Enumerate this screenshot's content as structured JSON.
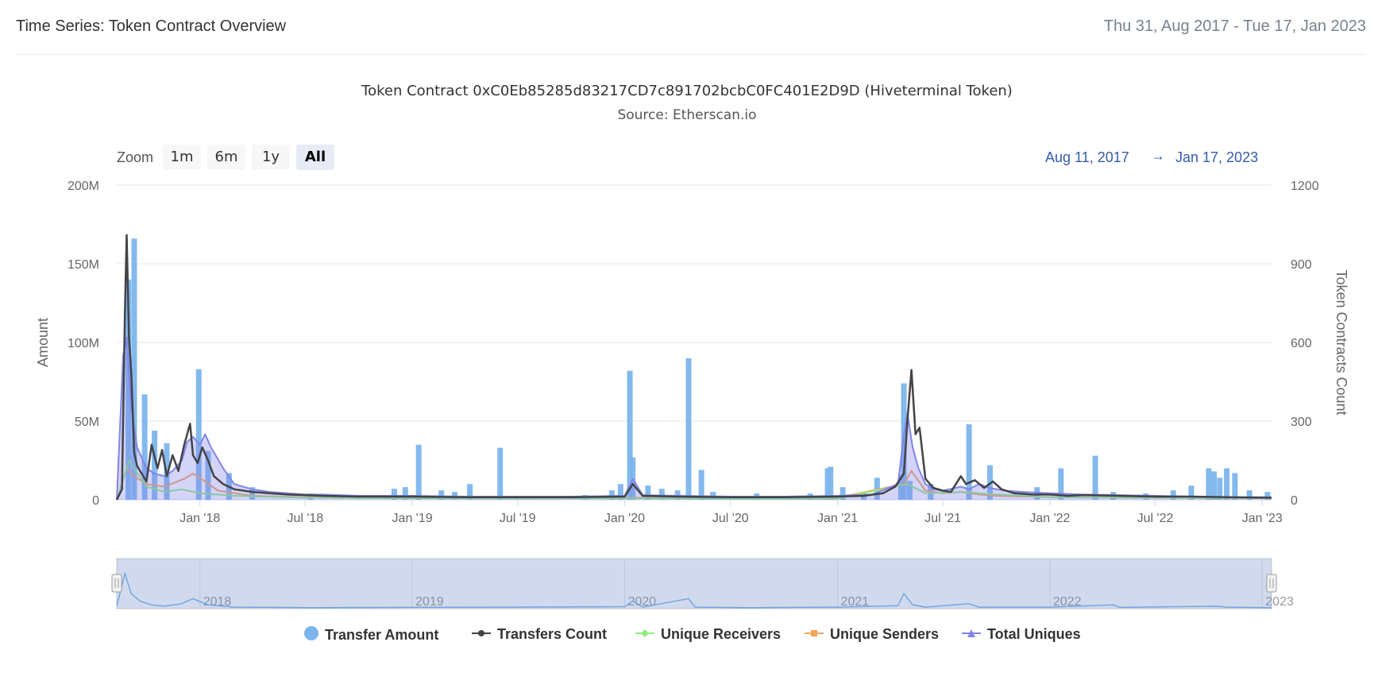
{
  "header": {
    "title": "Time Series: Token Contract Overview",
    "date_range": "Thu 31, Aug 2017 - Tue 17, Jan 2023"
  },
  "chart_data": {
    "type": "bar",
    "title": "Token Contract 0xC0Eb85285d83217CD7c891702bcbC0FC401E2D9D (Hiveterminal Token)",
    "subtitle": "Source: Etherscan.io",
    "ylabel": "Amount",
    "y2label": "Token Contracts Count",
    "ylim": [
      0,
      200000000
    ],
    "y2lim": [
      0,
      1200
    ],
    "yticks": [
      "0",
      "50M",
      "100M",
      "150M",
      "200M"
    ],
    "y2ticks": [
      "0",
      "300",
      "600",
      "900",
      "1200"
    ],
    "xlim": [
      "2017-08-11",
      "2023-01-17"
    ],
    "xticks": [
      {
        "label": "Jan '18",
        "date": "2018-01-01"
      },
      {
        "label": "Jul '18",
        "date": "2018-07-01"
      },
      {
        "label": "Jan '19",
        "date": "2019-01-01"
      },
      {
        "label": "Jul '19",
        "date": "2019-07-01"
      },
      {
        "label": "Jan '20",
        "date": "2020-01-01"
      },
      {
        "label": "Jul '20",
        "date": "2020-07-01"
      },
      {
        "label": "Jan '21",
        "date": "2021-01-01"
      },
      {
        "label": "Jul '21",
        "date": "2021-07-01"
      },
      {
        "label": "Jan '22",
        "date": "2022-01-01"
      },
      {
        "label": "Jul '22",
        "date": "2022-07-01"
      },
      {
        "label": "Jan '23",
        "date": "2023-01-01"
      }
    ],
    "navigator_ticks": [
      {
        "label": "2018",
        "date": "2018-01-01"
      },
      {
        "label": "2019",
        "date": "2019-01-01"
      },
      {
        "label": "2020",
        "date": "2020-01-01"
      },
      {
        "label": "2021",
        "date": "2021-01-01"
      },
      {
        "label": "2022",
        "date": "2022-01-01"
      },
      {
        "label": "2023",
        "date": "2023-01-01"
      }
    ],
    "grid": true,
    "legend_position": "bottom",
    "series": [
      {
        "name": "Transfer Amount",
        "type": "bar",
        "axis": "left",
        "color": "#7cb5ec",
        "x": [
          "2017-08-31",
          "2017-09-10",
          "2017-09-28",
          "2017-10-15",
          "2017-11-05",
          "2017-12-30",
          "2018-01-15",
          "2018-02-20",
          "2018-04-01",
          "2018-07-10",
          "2018-12-01",
          "2018-12-20",
          "2019-01-12",
          "2019-02-20",
          "2019-03-15",
          "2019-04-10",
          "2019-06-01",
          "2019-10-25",
          "2019-12-10",
          "2019-12-25",
          "2020-01-10",
          "2020-01-15",
          "2020-02-10",
          "2020-03-05",
          "2020-04-01",
          "2020-04-20",
          "2020-05-12",
          "2020-06-01",
          "2020-08-15",
          "2020-11-15",
          "2020-12-15",
          "2020-12-20",
          "2021-01-10",
          "2021-02-15",
          "2021-03-10",
          "2021-04-20",
          "2021-04-25",
          "2021-05-05",
          "2021-06-10",
          "2021-08-15",
          "2021-09-20",
          "2021-12-10",
          "2022-01-20",
          "2022-03-20",
          "2022-04-20",
          "2022-06-15",
          "2022-08-01",
          "2022-09-01",
          "2022-10-01",
          "2022-10-10",
          "2022-10-20",
          "2022-11-01",
          "2022-11-15",
          "2022-12-10",
          "2023-01-10"
        ],
        "values": [
          140000000,
          166000000,
          67000000,
          44000000,
          36000000,
          83000000,
          31000000,
          17000000,
          8000000,
          4000000,
          7000000,
          8000000,
          35000000,
          6000000,
          5000000,
          10000000,
          33000000,
          3000000,
          6000000,
          10000000,
          82000000,
          27000000,
          9000000,
          7000000,
          6000000,
          90000000,
          19000000,
          5000000,
          4000000,
          4000000,
          20000000,
          21000000,
          8000000,
          5000000,
          14000000,
          16000000,
          74000000,
          12000000,
          10000000,
          48000000,
          22000000,
          8000000,
          20000000,
          28000000,
          5000000,
          4000000,
          6000000,
          9000000,
          20000000,
          18000000,
          14000000,
          20000000,
          17000000,
          6000000,
          5000000
        ]
      },
      {
        "name": "Transfers Count",
        "type": "line",
        "axis": "right",
        "color": "#434348",
        "x": [
          "2017-08-11",
          "2017-08-20",
          "2017-08-25",
          "2017-08-28",
          "2017-09-01",
          "2017-09-05",
          "2017-09-10",
          "2017-09-15",
          "2017-09-20",
          "2017-10-01",
          "2017-10-10",
          "2017-10-20",
          "2017-10-28",
          "2017-11-05",
          "2017-11-15",
          "2017-11-25",
          "2017-12-05",
          "2017-12-15",
          "2017-12-20",
          "2017-12-28",
          "2018-01-05",
          "2018-01-15",
          "2018-01-25",
          "2018-02-10",
          "2018-03-01",
          "2018-04-01",
          "2018-05-01",
          "2018-06-01",
          "2018-07-01",
          "2018-08-01",
          "2018-10-01",
          "2019-01-01",
          "2019-04-01",
          "2019-07-01",
          "2019-10-01",
          "2020-01-01",
          "2020-01-15",
          "2020-02-01",
          "2020-04-01",
          "2020-07-01",
          "2020-10-01",
          "2021-01-01",
          "2021-02-15",
          "2021-03-20",
          "2021-04-10",
          "2021-04-25",
          "2021-05-01",
          "2021-05-08",
          "2021-05-15",
          "2021-05-22",
          "2021-06-01",
          "2021-06-15",
          "2021-07-01",
          "2021-07-15",
          "2021-08-01",
          "2021-08-10",
          "2021-08-25",
          "2021-09-10",
          "2021-09-25",
          "2021-10-10",
          "2021-11-01",
          "2021-12-01",
          "2022-01-01",
          "2022-02-01",
          "2022-03-01",
          "2022-05-01",
          "2022-07-01",
          "2022-09-01",
          "2022-11-01",
          "2023-01-17"
        ],
        "values": [
          0,
          40,
          720,
          1010,
          620,
          480,
          180,
          130,
          110,
          70,
          210,
          120,
          190,
          90,
          170,
          110,
          210,
          290,
          170,
          140,
          200,
          150,
          90,
          60,
          40,
          30,
          25,
          20,
          18,
          15,
          12,
          12,
          10,
          10,
          10,
          12,
          60,
          15,
          12,
          10,
          10,
          12,
          15,
          25,
          50,
          100,
          300,
          495,
          250,
          275,
          80,
          45,
          35,
          30,
          90,
          60,
          75,
          45,
          70,
          40,
          25,
          20,
          20,
          15,
          18,
          15,
          12,
          12,
          10,
          8
        ]
      },
      {
        "name": "Unique Receivers",
        "type": "line",
        "axis": "right",
        "color": "#90ed7d",
        "x": [
          "2017-08-11",
          "2017-09-01",
          "2017-10-01",
          "2017-11-01",
          "2017-12-01",
          "2018-01-01",
          "2018-03-01",
          "2018-07-01",
          "2019-01-01",
          "2019-07-01",
          "2020-01-01",
          "2020-07-01",
          "2021-01-01",
          "2021-05-01",
          "2021-06-01",
          "2021-08-01",
          "2021-10-01",
          "2022-01-01",
          "2022-07-01",
          "2023-01-17"
        ],
        "values": [
          0,
          150,
          50,
          30,
          40,
          25,
          15,
          8,
          6,
          5,
          6,
          4,
          5,
          60,
          25,
          30,
          20,
          10,
          8,
          6
        ]
      },
      {
        "name": "Unique Senders",
        "type": "line",
        "axis": "right",
        "color": "#f7a35c",
        "x": [
          "2017-08-11",
          "2017-08-28",
          "2017-09-10",
          "2017-10-01",
          "2017-11-01",
          "2017-12-05",
          "2017-12-20",
          "2018-01-10",
          "2018-02-01",
          "2018-04-01",
          "2018-07-01",
          "2019-01-01",
          "2019-07-01",
          "2020-01-01",
          "2020-07-01",
          "2021-01-01",
          "2021-04-25",
          "2021-05-08",
          "2021-06-01",
          "2021-07-01",
          "2021-08-01",
          "2021-09-01",
          "2021-10-01",
          "2022-01-01",
          "2022-07-01",
          "2023-01-17"
        ],
        "values": [
          0,
          120,
          90,
          60,
          50,
          80,
          100,
          70,
          35,
          15,
          10,
          8,
          6,
          8,
          6,
          8,
          60,
          110,
          35,
          25,
          30,
          20,
          15,
          10,
          8,
          6
        ]
      },
      {
        "name": "Total Uniques",
        "type": "line",
        "axis": "right",
        "color": "#8085e9",
        "x": [
          "2017-08-11",
          "2017-08-22",
          "2017-08-28",
          "2017-09-05",
          "2017-09-15",
          "2017-10-01",
          "2017-10-15",
          "2017-11-01",
          "2017-11-15",
          "2017-12-01",
          "2017-12-10",
          "2017-12-20",
          "2018-01-01",
          "2018-01-10",
          "2018-01-20",
          "2018-02-10",
          "2018-03-01",
          "2018-04-01",
          "2018-05-01",
          "2018-06-01",
          "2018-07-01",
          "2018-08-01",
          "2018-10-01",
          "2019-01-01",
          "2019-04-01",
          "2019-07-01",
          "2019-10-01",
          "2020-01-01",
          "2020-01-15",
          "2020-02-01",
          "2020-04-01",
          "2020-07-01",
          "2020-10-01",
          "2021-01-01",
          "2021-03-01",
          "2021-04-15",
          "2021-04-25",
          "2021-05-01",
          "2021-05-10",
          "2021-05-20",
          "2021-06-01",
          "2021-06-15",
          "2021-07-01",
          "2021-08-01",
          "2021-08-15",
          "2021-09-01",
          "2021-09-20",
          "2021-10-15",
          "2021-11-15",
          "2022-01-01",
          "2022-03-01",
          "2022-05-01",
          "2022-07-01",
          "2022-09-01",
          "2022-11-01",
          "2023-01-17"
        ],
        "values": [
          0,
          550,
          620,
          350,
          200,
          120,
          100,
          90,
          110,
          150,
          220,
          240,
          210,
          250,
          200,
          120,
          60,
          40,
          30,
          25,
          20,
          20,
          15,
          15,
          12,
          12,
          12,
          15,
          80,
          18,
          15,
          12,
          12,
          15,
          20,
          60,
          250,
          330,
          200,
          120,
          60,
          40,
          35,
          50,
          40,
          60,
          45,
          35,
          30,
          25,
          20,
          18,
          15,
          12,
          10,
          10
        ]
      }
    ],
    "navigator": {
      "x": [
        "2017-08-11",
        "2017-08-25",
        "2017-09-05",
        "2017-09-20",
        "2017-10-10",
        "2017-11-01",
        "2017-12-01",
        "2017-12-20",
        "2018-01-15",
        "2018-03-01",
        "2018-07-01",
        "2019-01-01",
        "2019-06-01",
        "2020-01-01",
        "2020-01-15",
        "2020-02-01",
        "2020-04-20",
        "2020-05-01",
        "2020-08-01",
        "2021-01-01",
        "2021-04-15",
        "2021-04-25",
        "2021-05-10",
        "2021-06-01",
        "2021-08-15",
        "2021-09-01",
        "2022-01-01",
        "2022-04-20",
        "2022-05-01",
        "2022-10-15",
        "2022-11-01",
        "2023-01-17"
      ],
      "values": [
        10000000,
        140000000,
        60000000,
        30000000,
        15000000,
        10000000,
        20000000,
        40000000,
        15000000,
        6000000,
        4000000,
        5000000,
        6000000,
        8000000,
        30000000,
        6000000,
        40000000,
        6000000,
        4000000,
        6000000,
        12000000,
        60000000,
        15000000,
        6000000,
        20000000,
        6000000,
        6000000,
        15000000,
        5000000,
        10000000,
        6000000,
        4000000
      ]
    }
  },
  "range_selector": {
    "zoom_label": "Zoom",
    "buttons": [
      "1m",
      "6m",
      "1y",
      "All"
    ],
    "active": "All",
    "from": "Aug 11, 2017",
    "arrow": "→",
    "to": "Jan 17, 2023"
  }
}
